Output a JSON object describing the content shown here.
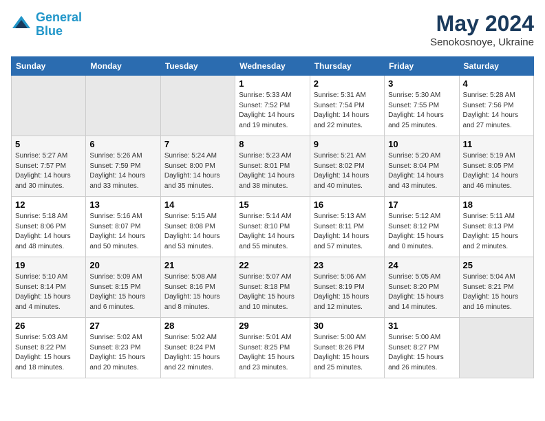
{
  "header": {
    "logo_line1": "General",
    "logo_line2": "Blue",
    "month_year": "May 2024",
    "location": "Senokosnoye, Ukraine"
  },
  "days_of_week": [
    "Sunday",
    "Monday",
    "Tuesday",
    "Wednesday",
    "Thursday",
    "Friday",
    "Saturday"
  ],
  "weeks": [
    [
      {
        "num": "",
        "info": ""
      },
      {
        "num": "",
        "info": ""
      },
      {
        "num": "",
        "info": ""
      },
      {
        "num": "1",
        "info": "Sunrise: 5:33 AM\nSunset: 7:52 PM\nDaylight: 14 hours\nand 19 minutes."
      },
      {
        "num": "2",
        "info": "Sunrise: 5:31 AM\nSunset: 7:54 PM\nDaylight: 14 hours\nand 22 minutes."
      },
      {
        "num": "3",
        "info": "Sunrise: 5:30 AM\nSunset: 7:55 PM\nDaylight: 14 hours\nand 25 minutes."
      },
      {
        "num": "4",
        "info": "Sunrise: 5:28 AM\nSunset: 7:56 PM\nDaylight: 14 hours\nand 27 minutes."
      }
    ],
    [
      {
        "num": "5",
        "info": "Sunrise: 5:27 AM\nSunset: 7:57 PM\nDaylight: 14 hours\nand 30 minutes."
      },
      {
        "num": "6",
        "info": "Sunrise: 5:26 AM\nSunset: 7:59 PM\nDaylight: 14 hours\nand 33 minutes."
      },
      {
        "num": "7",
        "info": "Sunrise: 5:24 AM\nSunset: 8:00 PM\nDaylight: 14 hours\nand 35 minutes."
      },
      {
        "num": "8",
        "info": "Sunrise: 5:23 AM\nSunset: 8:01 PM\nDaylight: 14 hours\nand 38 minutes."
      },
      {
        "num": "9",
        "info": "Sunrise: 5:21 AM\nSunset: 8:02 PM\nDaylight: 14 hours\nand 40 minutes."
      },
      {
        "num": "10",
        "info": "Sunrise: 5:20 AM\nSunset: 8:04 PM\nDaylight: 14 hours\nand 43 minutes."
      },
      {
        "num": "11",
        "info": "Sunrise: 5:19 AM\nSunset: 8:05 PM\nDaylight: 14 hours\nand 46 minutes."
      }
    ],
    [
      {
        "num": "12",
        "info": "Sunrise: 5:18 AM\nSunset: 8:06 PM\nDaylight: 14 hours\nand 48 minutes."
      },
      {
        "num": "13",
        "info": "Sunrise: 5:16 AM\nSunset: 8:07 PM\nDaylight: 14 hours\nand 50 minutes."
      },
      {
        "num": "14",
        "info": "Sunrise: 5:15 AM\nSunset: 8:08 PM\nDaylight: 14 hours\nand 53 minutes."
      },
      {
        "num": "15",
        "info": "Sunrise: 5:14 AM\nSunset: 8:10 PM\nDaylight: 14 hours\nand 55 minutes."
      },
      {
        "num": "16",
        "info": "Sunrise: 5:13 AM\nSunset: 8:11 PM\nDaylight: 14 hours\nand 57 minutes."
      },
      {
        "num": "17",
        "info": "Sunrise: 5:12 AM\nSunset: 8:12 PM\nDaylight: 15 hours\nand 0 minutes."
      },
      {
        "num": "18",
        "info": "Sunrise: 5:11 AM\nSunset: 8:13 PM\nDaylight: 15 hours\nand 2 minutes."
      }
    ],
    [
      {
        "num": "19",
        "info": "Sunrise: 5:10 AM\nSunset: 8:14 PM\nDaylight: 15 hours\nand 4 minutes."
      },
      {
        "num": "20",
        "info": "Sunrise: 5:09 AM\nSunset: 8:15 PM\nDaylight: 15 hours\nand 6 minutes."
      },
      {
        "num": "21",
        "info": "Sunrise: 5:08 AM\nSunset: 8:16 PM\nDaylight: 15 hours\nand 8 minutes."
      },
      {
        "num": "22",
        "info": "Sunrise: 5:07 AM\nSunset: 8:18 PM\nDaylight: 15 hours\nand 10 minutes."
      },
      {
        "num": "23",
        "info": "Sunrise: 5:06 AM\nSunset: 8:19 PM\nDaylight: 15 hours\nand 12 minutes."
      },
      {
        "num": "24",
        "info": "Sunrise: 5:05 AM\nSunset: 8:20 PM\nDaylight: 15 hours\nand 14 minutes."
      },
      {
        "num": "25",
        "info": "Sunrise: 5:04 AM\nSunset: 8:21 PM\nDaylight: 15 hours\nand 16 minutes."
      }
    ],
    [
      {
        "num": "26",
        "info": "Sunrise: 5:03 AM\nSunset: 8:22 PM\nDaylight: 15 hours\nand 18 minutes."
      },
      {
        "num": "27",
        "info": "Sunrise: 5:02 AM\nSunset: 8:23 PM\nDaylight: 15 hours\nand 20 minutes."
      },
      {
        "num": "28",
        "info": "Sunrise: 5:02 AM\nSunset: 8:24 PM\nDaylight: 15 hours\nand 22 minutes."
      },
      {
        "num": "29",
        "info": "Sunrise: 5:01 AM\nSunset: 8:25 PM\nDaylight: 15 hours\nand 23 minutes."
      },
      {
        "num": "30",
        "info": "Sunrise: 5:00 AM\nSunset: 8:26 PM\nDaylight: 15 hours\nand 25 minutes."
      },
      {
        "num": "31",
        "info": "Sunrise: 5:00 AM\nSunset: 8:27 PM\nDaylight: 15 hours\nand 26 minutes."
      },
      {
        "num": "",
        "info": ""
      }
    ]
  ]
}
